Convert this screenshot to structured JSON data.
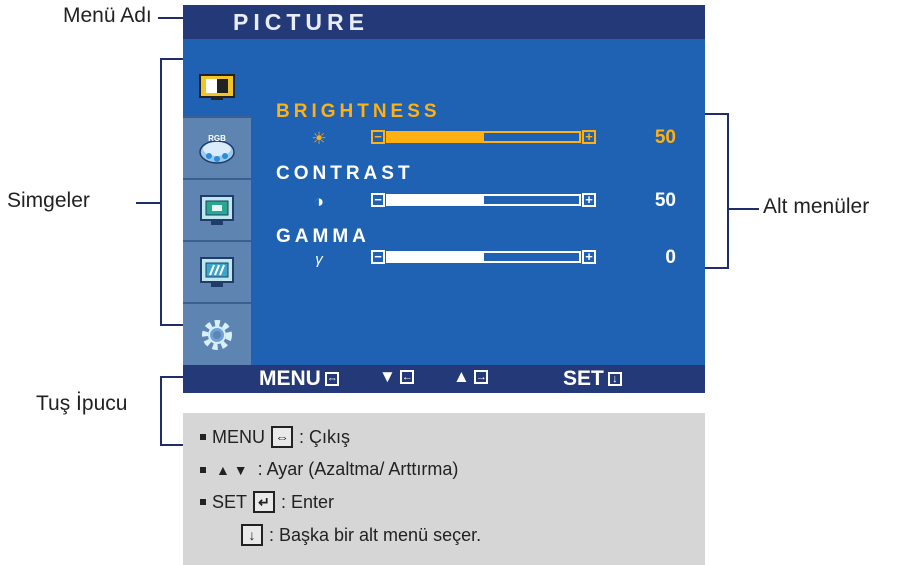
{
  "annotations": {
    "menu_name": "Menü Adı",
    "icons": "Simgeler",
    "submenus": "Alt menüler",
    "key_hint": "Tuş İpucu"
  },
  "osd": {
    "title": "PICTURE",
    "icons": [
      {
        "name": "picture-icon",
        "active": true
      },
      {
        "name": "rgb-color-icon",
        "label": "RGB"
      },
      {
        "name": "position-monitor-icon"
      },
      {
        "name": "tracking-monitor-icon"
      },
      {
        "name": "setup-gear-icon"
      }
    ],
    "submenus": [
      {
        "label": "BRIGHTNESS",
        "icon": "brightness-sun-icon",
        "glyph": "☀",
        "value": "50",
        "level": 0.5,
        "active": true
      },
      {
        "label": "CONTRAST",
        "icon": "contrast-half-circle-icon",
        "glyph": "◑",
        "value": "50",
        "level": 0.5,
        "active": false
      },
      {
        "label": "GAMMA",
        "icon": "gamma-icon",
        "glyph": "γ",
        "value": "0",
        "level": 0.5,
        "active": false
      }
    ],
    "footer": {
      "menu_label": "MENU",
      "down_label": "▼",
      "up_label": "▲",
      "set_label": "SET"
    }
  },
  "legend": {
    "line1": {
      "prefix": "MENU",
      "text": ": Çıkış"
    },
    "line2": {
      "prefix": "▲ ▼",
      "text": ": Ayar (Azaltma/ Arttırma)"
    },
    "line3": {
      "prefix": "SET",
      "text": ": Enter"
    },
    "line4": {
      "text": ": Başka bir alt menü seçer."
    }
  },
  "colors": {
    "osd_body": "#1f62b4",
    "osd_bar": "#243a78",
    "icon_column": "#5e84b2",
    "highlight": "#ffb012",
    "legend_bg": "#d6d6d6",
    "leader_lines": "#1f2d6b"
  }
}
